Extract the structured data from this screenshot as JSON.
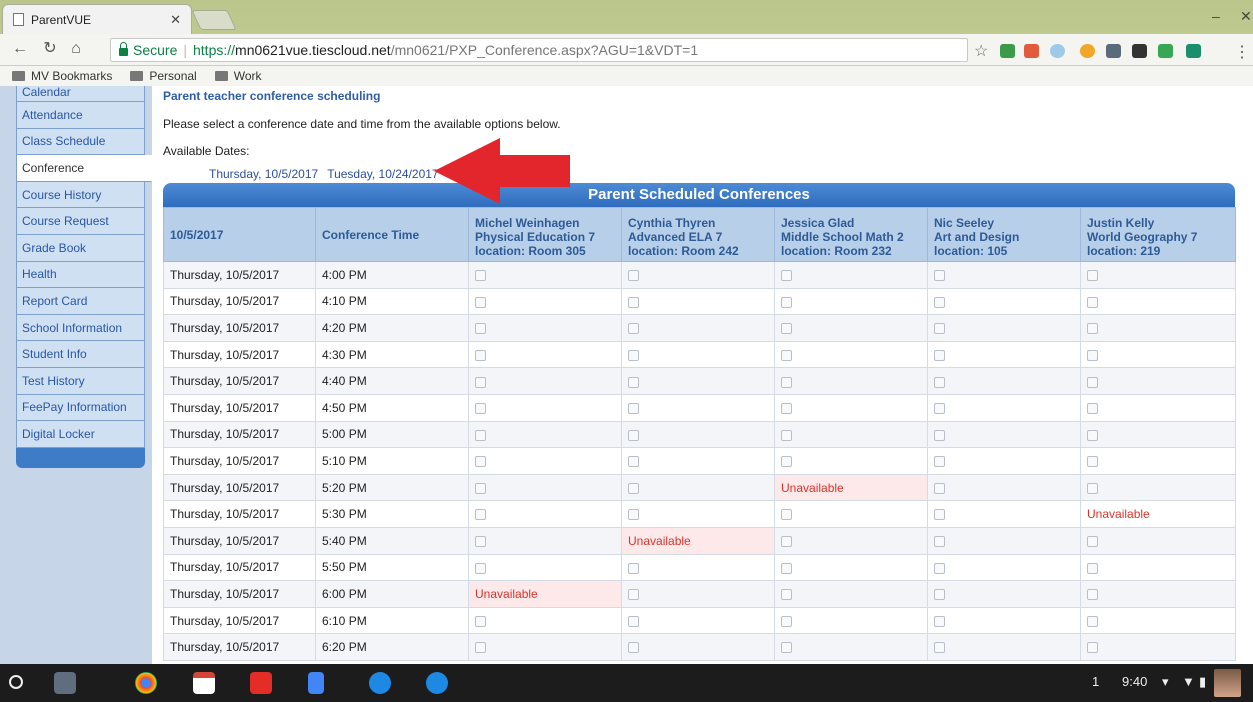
{
  "browser": {
    "tab_title": "ParentVUE",
    "secure_label": "Secure",
    "url_scheme": "https://",
    "url_host": "mn0621vue.tiescloud.net",
    "url_path": "/mn0621/PXP_Conference.aspx?AGU=1&VDT=1",
    "bookmarks": [
      "MV Bookmarks",
      "Personal",
      "Work"
    ]
  },
  "sidebar": {
    "items": [
      {
        "label": "Calendar"
      },
      {
        "label": "Attendance"
      },
      {
        "label": "Class Schedule"
      },
      {
        "label": "Conference",
        "active": true
      },
      {
        "label": "Course History"
      },
      {
        "label": "Course Request"
      },
      {
        "label": "Grade Book"
      },
      {
        "label": "Health"
      },
      {
        "label": "Report Card"
      },
      {
        "label": "School Information"
      },
      {
        "label": "Student Info"
      },
      {
        "label": "Test History"
      },
      {
        "label": "FeePay Information"
      },
      {
        "label": "Digital Locker"
      }
    ]
  },
  "content": {
    "heading": "Parent teacher conference scheduling",
    "intro": "Please select a conference date and time from the available options below.",
    "available_label": "Available Dates:",
    "dates": [
      "Thursday, 10/5/2017",
      "Tuesday, 10/24/2017"
    ]
  },
  "table": {
    "title": "Parent Scheduled Conferences",
    "date_header": "10/5/2017",
    "time_header": "Conference Time",
    "teachers": [
      {
        "name": "Michel Weinhagen",
        "course": "Physical Education 7",
        "location": "location: Room 305"
      },
      {
        "name": "Cynthia Thyren",
        "course": "Advanced ELA 7",
        "location": "location: Room 242"
      },
      {
        "name": "Jessica Glad",
        "course": "Middle School Math 2",
        "location": "location: Room 232"
      },
      {
        "name": "Nic Seeley",
        "course": "Art and Design",
        "location": "location: 105"
      },
      {
        "name": "Justin Kelly",
        "course": "World Geography 7",
        "location": "location: 219"
      }
    ],
    "unavailable_label": "Unavailable",
    "rows": [
      {
        "date": "Thursday, 10/5/2017",
        "time": "4:00 PM",
        "unavailable": []
      },
      {
        "date": "Thursday, 10/5/2017",
        "time": "4:10 PM",
        "unavailable": []
      },
      {
        "date": "Thursday, 10/5/2017",
        "time": "4:20 PM",
        "unavailable": []
      },
      {
        "date": "Thursday, 10/5/2017",
        "time": "4:30 PM",
        "unavailable": []
      },
      {
        "date": "Thursday, 10/5/2017",
        "time": "4:40 PM",
        "unavailable": []
      },
      {
        "date": "Thursday, 10/5/2017",
        "time": "4:50 PM",
        "unavailable": []
      },
      {
        "date": "Thursday, 10/5/2017",
        "time": "5:00 PM",
        "unavailable": []
      },
      {
        "date": "Thursday, 10/5/2017",
        "time": "5:10 PM",
        "unavailable": []
      },
      {
        "date": "Thursday, 10/5/2017",
        "time": "5:20 PM",
        "unavailable": [
          2
        ]
      },
      {
        "date": "Thursday, 10/5/2017",
        "time": "5:30 PM",
        "unavailable": [
          4
        ]
      },
      {
        "date": "Thursday, 10/5/2017",
        "time": "5:40 PM",
        "unavailable": [
          1
        ]
      },
      {
        "date": "Thursday, 10/5/2017",
        "time": "5:50 PM",
        "unavailable": []
      },
      {
        "date": "Thursday, 10/5/2017",
        "time": "6:00 PM",
        "unavailable": [
          0
        ]
      },
      {
        "date": "Thursday, 10/5/2017",
        "time": "6:10 PM",
        "unavailable": []
      },
      {
        "date": "Thursday, 10/5/2017",
        "time": "6:20 PM",
        "unavailable": []
      }
    ]
  },
  "shelf": {
    "notification_count": "1",
    "time": "9:40"
  },
  "colors": {
    "accent": "#2f6cbd",
    "unavailable_text": "#d9342b",
    "annotation_arrow": "#e3262c"
  }
}
